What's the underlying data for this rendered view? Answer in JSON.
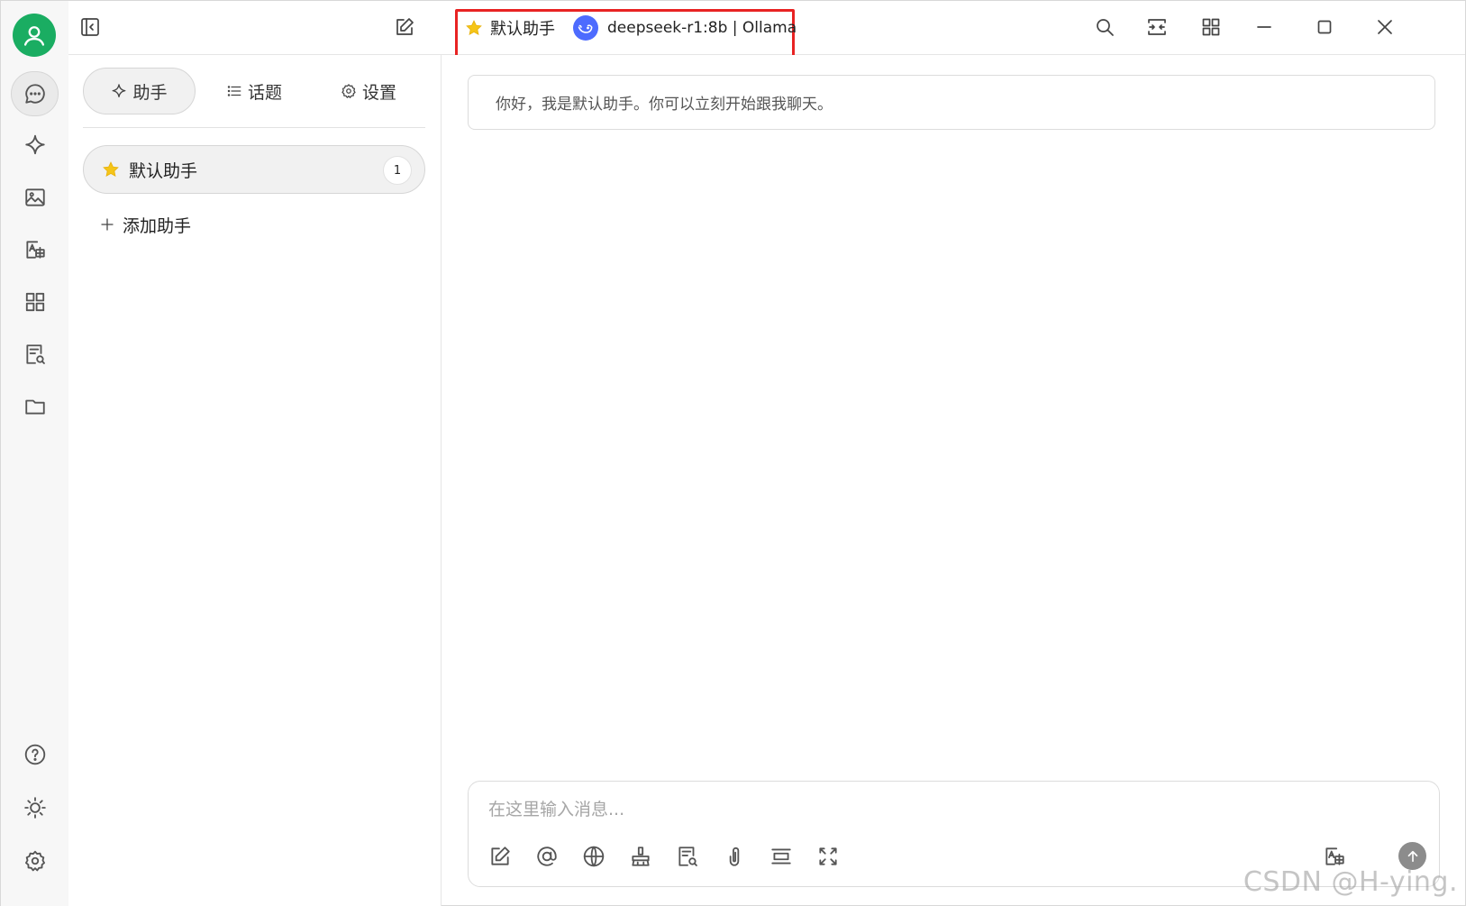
{
  "titlebar": {
    "assistant_name": "默认助手",
    "model_label": "deepseek-r1:8b | Ollama"
  },
  "panel": {
    "tabs": [
      {
        "label": "助手",
        "icon": "sparkle-icon"
      },
      {
        "label": "话题",
        "icon": "list-icon"
      },
      {
        "label": "设置",
        "icon": "gear-icon"
      }
    ],
    "assistants": [
      {
        "name": "默认助手",
        "count": "1",
        "icon": "star-icon"
      }
    ],
    "add_assistant_label": "添加助手"
  },
  "chat": {
    "greeting": "你好，我是默认助手。你可以立刻开始跟我聊天。",
    "input_placeholder": "在这里输入消息..."
  },
  "watermark": "CSDN @H-ying.",
  "colors": {
    "avatar": "#1aad62",
    "highlight": "#e82323",
    "star": "#f5c518",
    "model_logo": "#4d6bfe",
    "send_button": "#8c8c8c"
  }
}
